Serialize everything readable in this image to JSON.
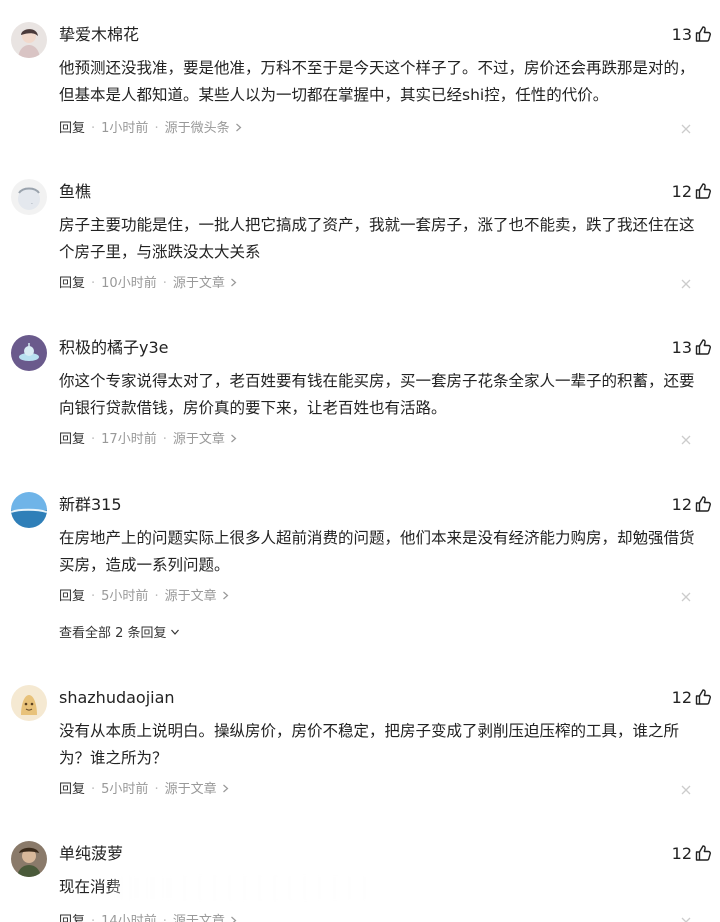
{
  "comments": [
    {
      "username": "挚爱木棉花",
      "likes": "13",
      "text": "他预测还没我准，要是他准，万科不至于是今天这个样子了。不过，房价还会再跌那是对的，但基本是人都知道。某些人以为一切都在掌握中，其实已经shi控，任性的代价。",
      "reply_label": "回复",
      "time": "1小时前",
      "source": "源于微头条"
    },
    {
      "username": "鱼樵",
      "likes": "12",
      "text": "房子主要功能是住，一批人把它搞成了资产，我就一套房子，涨了也不能卖，跌了我还住在这个房子里，与涨跌没太大关系",
      "reply_label": "回复",
      "time": "10小时前",
      "source": "源于文章"
    },
    {
      "username": "积极的橘子y3e",
      "likes": "13",
      "text": "你这个专家说得太对了，老百姓要有钱在能买房，买一套房子花条全家人一辈子的积蓄，还要向银行贷款借钱，房价真的要下来，让老百姓也有活路。",
      "reply_label": "回复",
      "time": "17小时前",
      "source": "源于文章"
    },
    {
      "username": "新群315",
      "likes": "12",
      "text": "在房地产上的问题实际上很多人超前消费的问题，他们本来是没有经济能力购房，却勉强借货买房，造成一系列问题。",
      "reply_label": "回复",
      "time": "5小时前",
      "source": "源于文章",
      "view_all": "查看全部 2 条回复"
    },
    {
      "username": "shazhudaojian",
      "likes": "12",
      "text": "没有从本质上说明白。操纵房价，房价不稳定，把房子变成了剥削压迫压榨的工具，谁之所为？谁之所为？",
      "reply_label": "回复",
      "time": "5小时前",
      "source": "源于文章"
    },
    {
      "username": "单纯菠萝",
      "likes": "12",
      "text": "现在消费",
      "reply_label": "回复",
      "time": "14小时前",
      "source": "源于文章"
    }
  ],
  "icons": {
    "like": "thumbs-up-icon",
    "close": "close-icon",
    "chevron": "chevron-right-icon",
    "expand": "chevron-down-icon"
  },
  "colors": {
    "text": "#222222",
    "meta": "#999999",
    "close": "#cccccc"
  }
}
